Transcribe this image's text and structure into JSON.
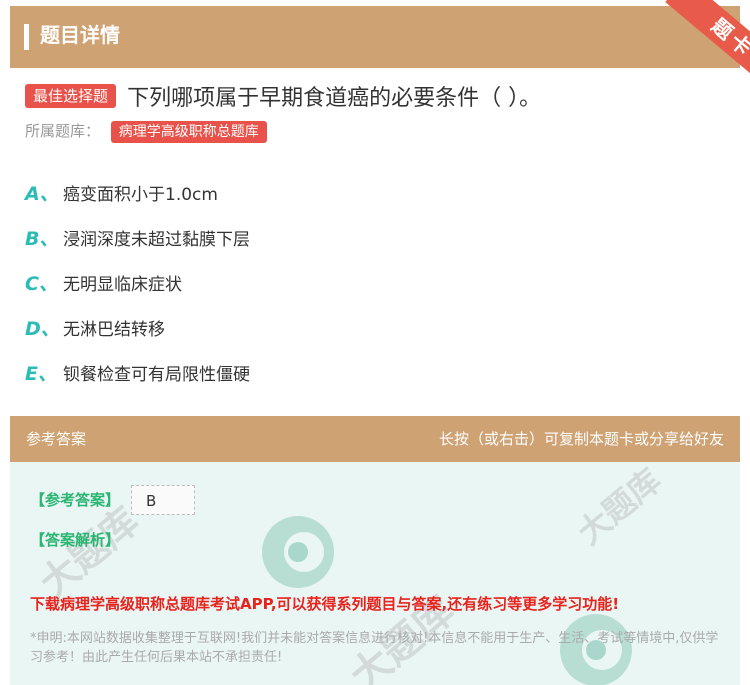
{
  "header": {
    "title": "题目详情",
    "ribbon": "题卡"
  },
  "question": {
    "type_badge": "最佳选择题",
    "text": "下列哪项属于早期食道癌的必要条件（ ）。",
    "source_label": "所属题库：",
    "source_badge": "病理学高级职称总题库"
  },
  "options": [
    {
      "letter": "A、",
      "text": "癌变面积小于1.0cm"
    },
    {
      "letter": "B、",
      "text": "浸润深度未超过黏膜下层"
    },
    {
      "letter": "C、",
      "text": "无明显临床症状"
    },
    {
      "letter": "D、",
      "text": "无淋巴结转移"
    },
    {
      "letter": "E、",
      "text": "钡餐检查可有局限性僵硬"
    }
  ],
  "answer_section": {
    "title": "参考答案",
    "hint": "长按（或右击）可复制本题卡或分享给好友",
    "answer_label": "【参考答案】",
    "answer_value": "B",
    "analysis_label": "【答案解析】",
    "promo": "下载病理学高级职称总题库考试APP,可以获得系列题目与答案,还有练习等更多学习功能!",
    "notice": "*申明:本网站数据收集整理于互联网!我们并未能对答案信息进行核对!本信息不能用于生产、生活、考试等情境中,仅供学习参考！由此产生任何后果本站不承担责任!"
  },
  "colors": {
    "header": "#cfa274",
    "badge": "#e8524a",
    "letter": "#2bbcb5",
    "green": "#2bb573",
    "promo": "#e8231e",
    "answer_bg": "#eaf6f4"
  }
}
